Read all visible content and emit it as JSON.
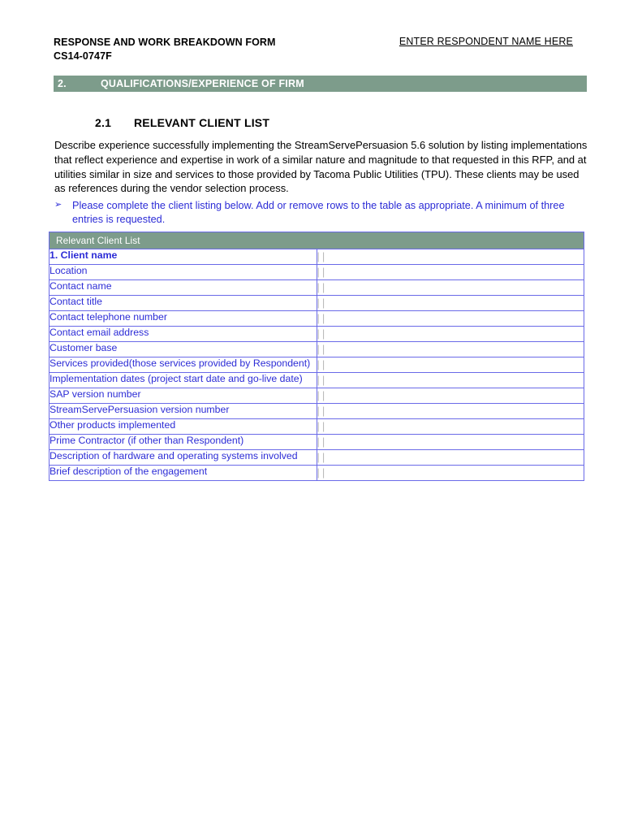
{
  "header": {
    "title_line1": "RESPONSE AND WORK BREAKDOWN FORM",
    "title_line2": "CS14-0747F",
    "respondent_placeholder": "ENTER RESPONDENT NAME HERE"
  },
  "section": {
    "number": "2.",
    "title": "QUALIFICATIONS/EXPERIENCE OF FIRM",
    "bar_color": "#7d9c8b"
  },
  "subsection": {
    "number": "2.1",
    "title": "RELEVANT CLIENT LIST"
  },
  "body": {
    "paragraph": "Describe experience successfully implementing the StreamServePersuasion 5.6 solution by listing implementations that reflect experience and expertise in work of a similar nature and magnitude to that requested in this RFP, and at utilities similar in size and services to those provided by Tacoma Public Utilities (TPU).  These clients may be used as references during the vendor selection process."
  },
  "instruction": {
    "bullet_glyph": "➢",
    "text": "Please complete the client listing below. Add or remove rows to the table as appropriate.  A minimum of three entries is requested.",
    "color": "#2c2cd6"
  },
  "table": {
    "caption": "Relevant Client List",
    "field_marker": "||",
    "rows": [
      {
        "label": "1. Client name",
        "bold": true,
        "value": "",
        "tall": false
      },
      {
        "label": "Location",
        "bold": false,
        "value": "",
        "tall": false
      },
      {
        "label": "Contact name",
        "bold": false,
        "value": "",
        "tall": false
      },
      {
        "label": "Contact title",
        "bold": false,
        "value": "",
        "tall": false
      },
      {
        "label": "Contact telephone number",
        "bold": false,
        "value": "",
        "tall": false
      },
      {
        "label": "Contact email address",
        "bold": false,
        "value": "",
        "tall": false
      },
      {
        "label": "Customer base",
        "bold": false,
        "value": "",
        "tall": false
      },
      {
        "label": "Services provided(those services provided by Respondent)",
        "bold": false,
        "value": "",
        "tall": true
      },
      {
        "label": "Implementation dates (project start date and go-live date)",
        "bold": false,
        "value": "",
        "tall": true
      },
      {
        "label": "SAP version number",
        "bold": false,
        "value": "",
        "tall": false
      },
      {
        "label": "StreamServePersuasion version number",
        "bold": false,
        "value": "",
        "tall": false
      },
      {
        "label": "Other products implemented",
        "bold": false,
        "value": "",
        "tall": false
      },
      {
        "label": "Prime Contractor (if other than Respondent)",
        "bold": false,
        "value": "",
        "tall": true
      },
      {
        "label": "Description of hardware and operating systems involved",
        "bold": false,
        "value": "",
        "tall": true
      },
      {
        "label": "Brief description of the engagement",
        "bold": false,
        "value": "",
        "tall": false
      }
    ],
    "border_color": "#6a6ae8",
    "label_color": "#2c2cd6"
  }
}
